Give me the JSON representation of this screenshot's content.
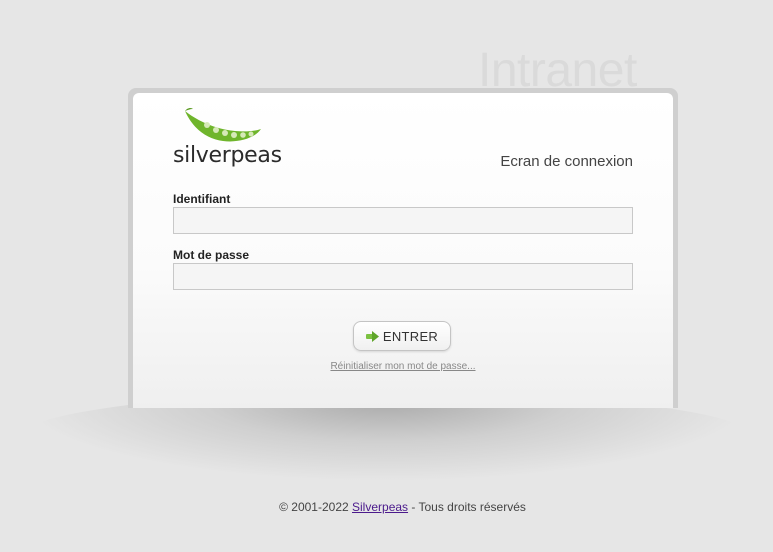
{
  "header": {
    "watermark": "Intranet"
  },
  "brand": {
    "logo_text": "silverpeas",
    "logo_colors": {
      "pod": "#6fb52c",
      "pea": "#d6e9b8"
    }
  },
  "login": {
    "screen_title": "Ecran de connexion",
    "username_label": "Identifiant",
    "username_value": "",
    "password_label": "Mot de passe",
    "password_value": "",
    "submit_label": "ENTRER",
    "submit_icon": "arrow-right-icon",
    "reset_link": "Réinitialiser mon mot de passe..."
  },
  "footer": {
    "copyright": "© 2001-2022",
    "company_link": "Silverpeas",
    "rights": "- Tous droits réservés"
  },
  "colors": {
    "accent_green": "#6fb52c",
    "link_purple": "#4b1a8c"
  }
}
